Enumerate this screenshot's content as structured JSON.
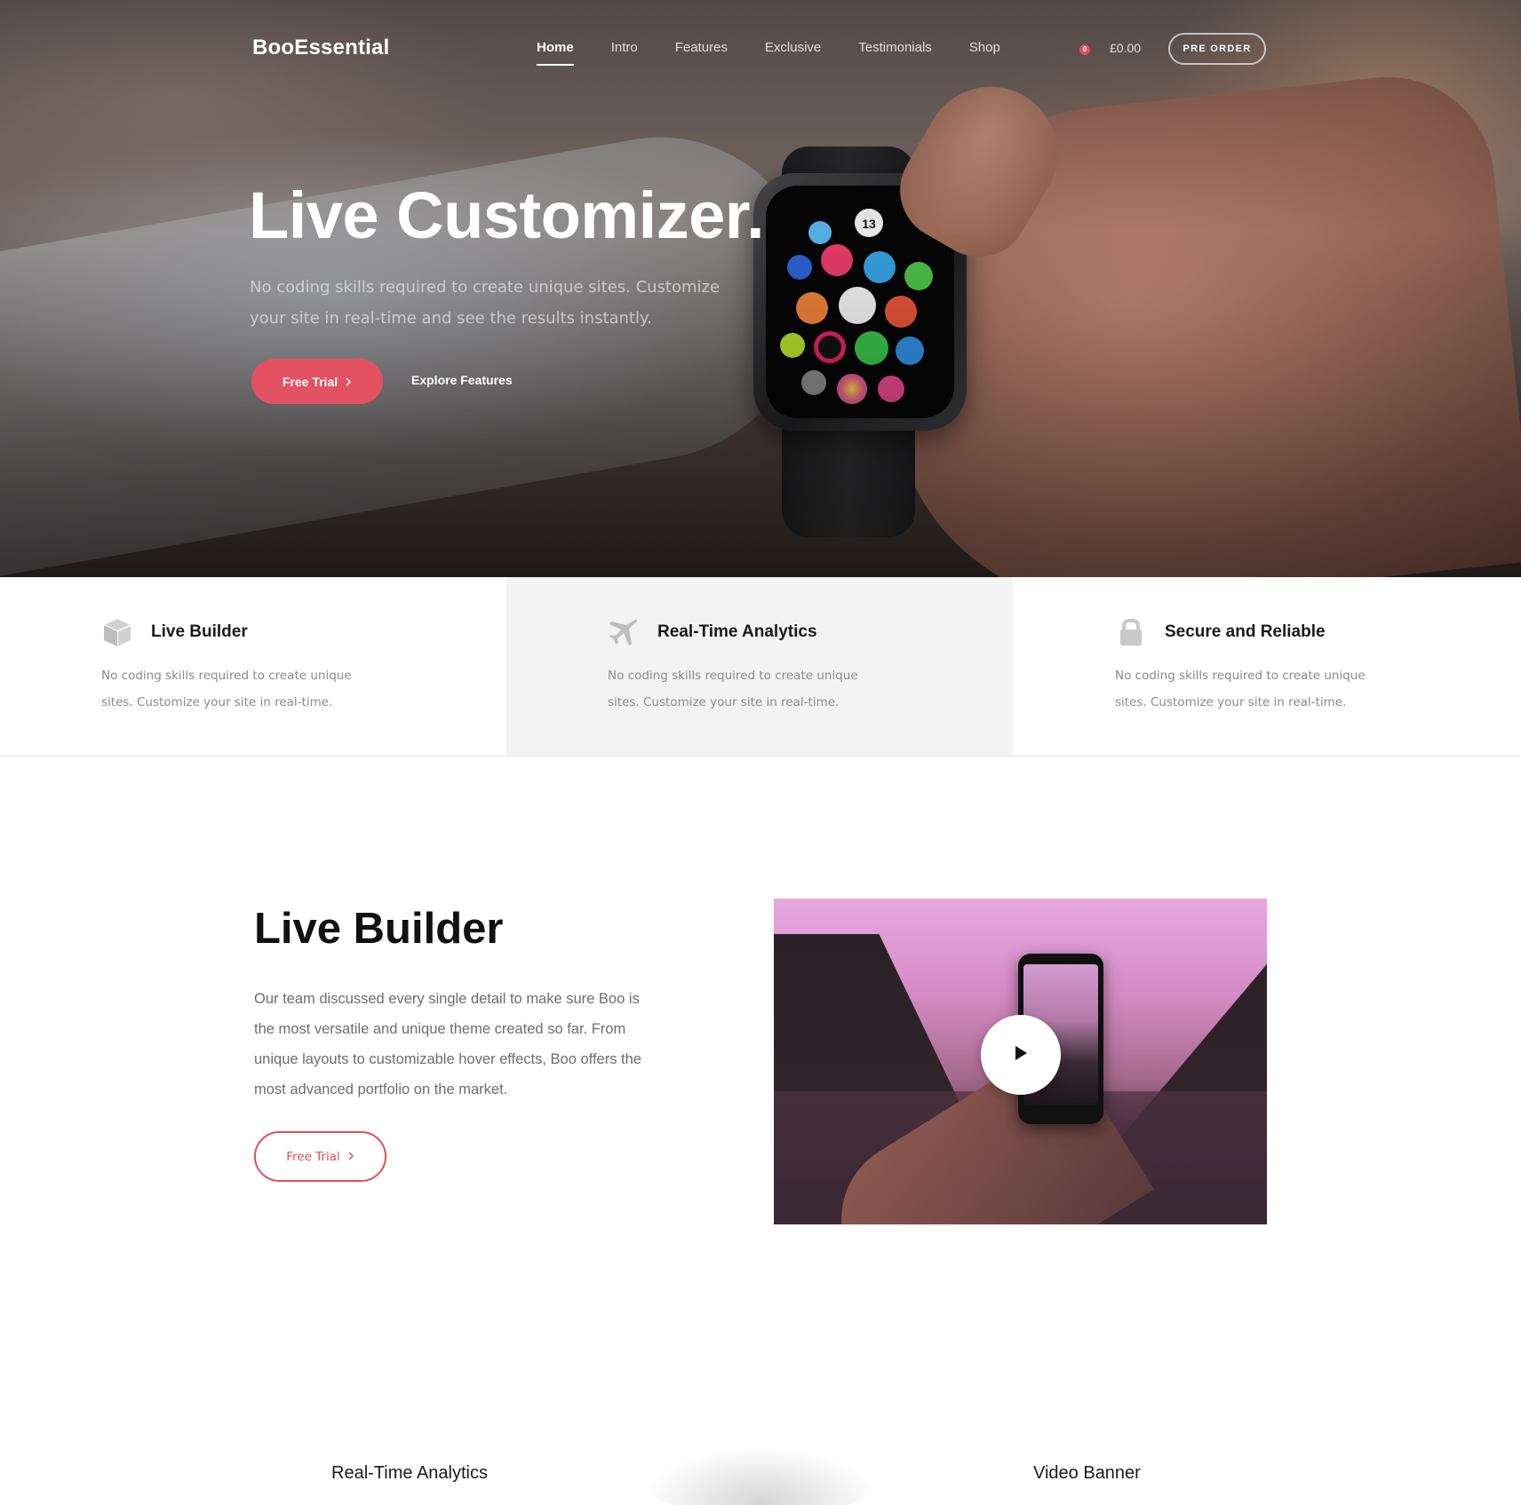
{
  "brand": {
    "logo": "BooEssential"
  },
  "nav": {
    "items": [
      {
        "label": "Home",
        "active": true
      },
      {
        "label": "Intro",
        "active": false
      },
      {
        "label": "Features",
        "active": false
      },
      {
        "label": "Exclusive",
        "active": false
      },
      {
        "label": "Testimonials",
        "active": false
      },
      {
        "label": "Shop",
        "active": false
      }
    ],
    "cart_count": "0",
    "cart_total": "£0.00",
    "pre_order_label": "PRE ORDER"
  },
  "hero": {
    "title": "Live Customizer.",
    "subtitle": "No coding skills required to create unique sites. Customize your site in real-time and see the results instantly.",
    "primary_cta": "Free Trial",
    "secondary_cta": "Explore Features",
    "watch_date": "13"
  },
  "features": [
    {
      "icon": "box-icon",
      "title": "Live Builder",
      "description": "No coding skills required to create unique sites. Customize your site in real-time."
    },
    {
      "icon": "plane-icon",
      "title": "Real-Time Analytics",
      "description": "No coding skills required to create unique sites. Customize your site in real-time."
    },
    {
      "icon": "lock-icon",
      "title": "Secure and Reliable",
      "description": "No coding skills required to create unique sites. Customize your site in real-time."
    }
  ],
  "live_builder": {
    "title": "Live Builder",
    "text": "Our team discussed every single detail to make sure Boo is the most versatile and unique theme created so far. From unique layouts to customizable hover effects, Boo offers the most advanced portfolio on the market.",
    "cta": "Free Trial"
  },
  "bottom": {
    "left_label": "Real-Time Analytics",
    "right_label": "Video Banner"
  },
  "colors": {
    "accent": "#e35262",
    "strip_highlight": "#f3f3f3"
  }
}
